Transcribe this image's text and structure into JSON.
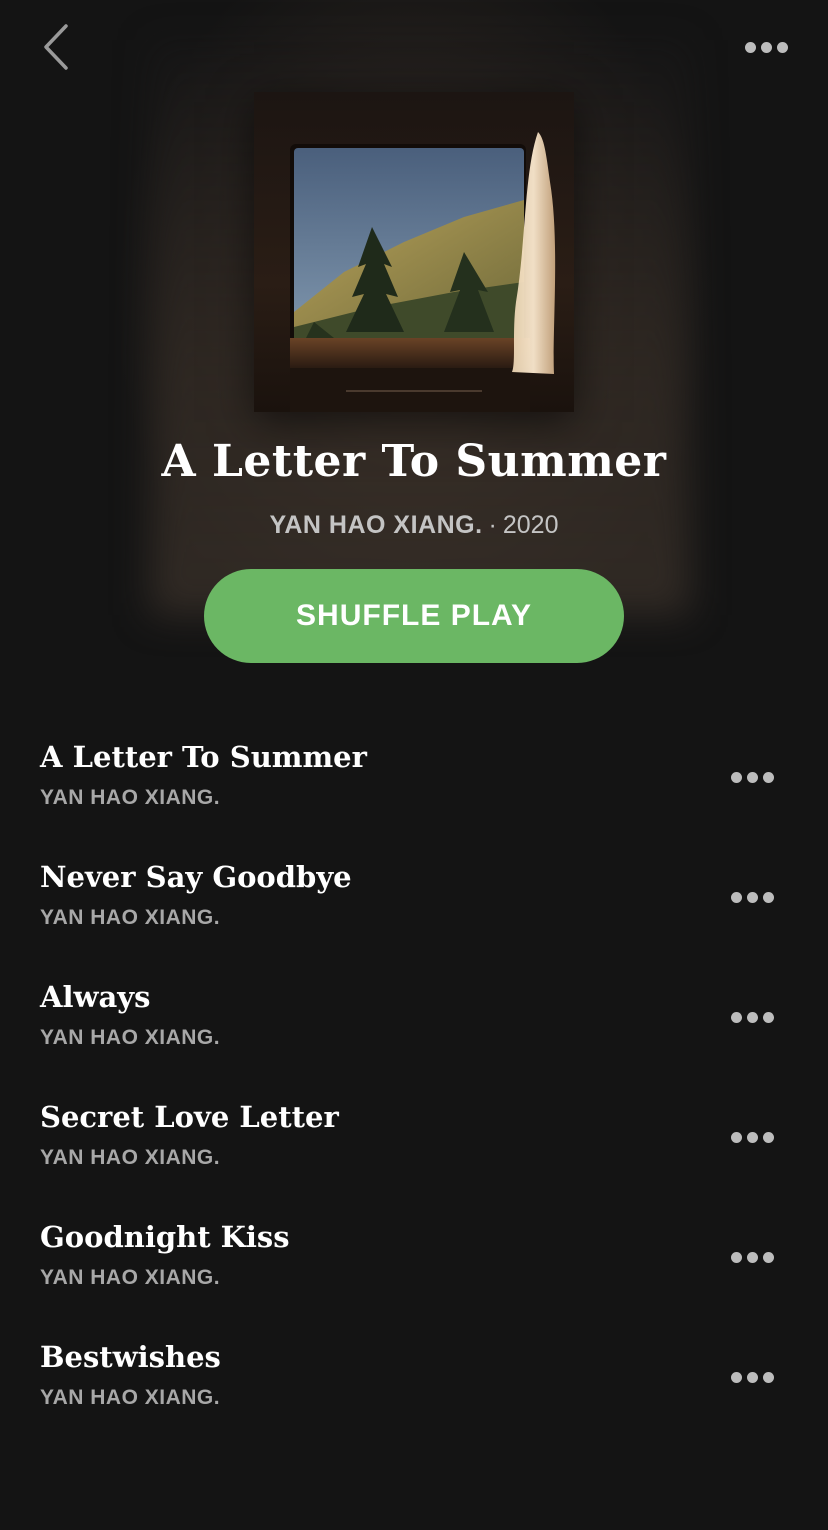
{
  "header": {
    "back_icon": "chevron-left-icon",
    "more_icon": "more-horizontal-icon"
  },
  "album": {
    "title": "A Letter To Summer",
    "artist": "YAN HAO XIANG.",
    "separator": "·",
    "year": "2020",
    "cover_description_icon": "album-cover"
  },
  "actions": {
    "shuffle_label": "SHUFFLE PLAY",
    "accent_color": "#6bb764"
  },
  "tracks": [
    {
      "title": "A Letter To Summer",
      "artist": "YAN HAO XIANG."
    },
    {
      "title": "Never Say Goodbye",
      "artist": "YAN HAO XIANG."
    },
    {
      "title": "Always",
      "artist": "YAN HAO XIANG."
    },
    {
      "title": "Secret Love Letter",
      "artist": "YAN HAO XIANG."
    },
    {
      "title": "Goodnight Kiss",
      "artist": "YAN HAO XIANG."
    },
    {
      "title": "Bestwishes",
      "artist": "YAN HAO XIANG."
    }
  ]
}
